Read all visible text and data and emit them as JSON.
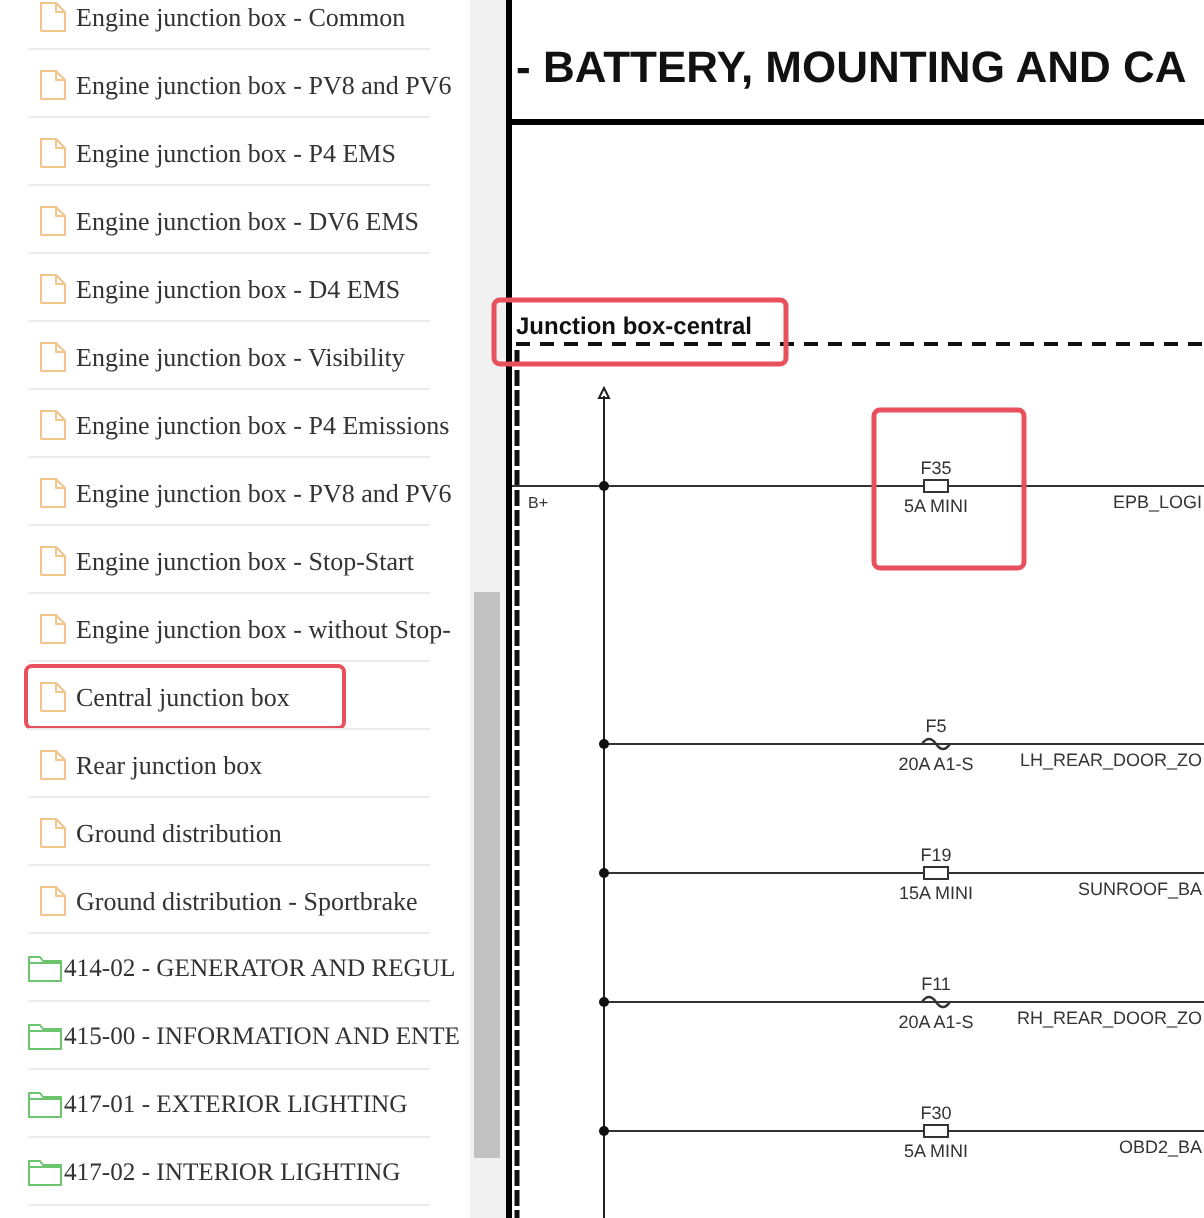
{
  "sidebar": {
    "items": [
      {
        "kind": "file",
        "label": "Engine junction box - Common",
        "highlighted": false
      },
      {
        "kind": "file",
        "label": "Engine junction box - PV8 and PV6",
        "highlighted": false
      },
      {
        "kind": "file",
        "label": "Engine junction box - P4 EMS",
        "highlighted": false
      },
      {
        "kind": "file",
        "label": "Engine junction box - DV6 EMS",
        "highlighted": false
      },
      {
        "kind": "file",
        "label": "Engine junction box - D4 EMS",
        "highlighted": false
      },
      {
        "kind": "file",
        "label": "Engine junction box - Visibility",
        "highlighted": false
      },
      {
        "kind": "file",
        "label": "Engine junction box - P4 Emissions",
        "highlighted": false
      },
      {
        "kind": "file",
        "label": "Engine junction box - PV8 and PV6",
        "highlighted": false
      },
      {
        "kind": "file",
        "label": "Engine junction box - Stop-Start",
        "highlighted": false
      },
      {
        "kind": "file",
        "label": "Engine junction box - without Stop-",
        "highlighted": false
      },
      {
        "kind": "file",
        "label": "Central junction box",
        "highlighted": true
      },
      {
        "kind": "file",
        "label": "Rear junction box",
        "highlighted": false
      },
      {
        "kind": "file",
        "label": "Ground distribution",
        "highlighted": false
      },
      {
        "kind": "file",
        "label": "Ground distribution - Sportbrake",
        "highlighted": false
      },
      {
        "kind": "folder",
        "label": "414-02 - GENERATOR AND REGUL",
        "highlighted": false
      },
      {
        "kind": "folder",
        "label": "415-00 - INFORMATION AND ENTE",
        "highlighted": false
      },
      {
        "kind": "folder",
        "label": "417-01 - EXTERIOR LIGHTING",
        "highlighted": false
      },
      {
        "kind": "folder",
        "label": "417-02 - INTERIOR LIGHTING",
        "highlighted": false
      }
    ]
  },
  "diagram": {
    "title": "- BATTERY, MOUNTING AND CA",
    "junction_box": {
      "label": "Junction box-central",
      "highlighted": true
    },
    "supply": {
      "label": "B+"
    },
    "circuits": [
      {
        "fuse": "F35",
        "rating": "5A MINI",
        "kind": "box",
        "signal": "EPB_LOGI",
        "highlighted": true
      },
      {
        "fuse": "F5",
        "rating": "20A A1-S",
        "kind": "wave",
        "signal": "LH_REAR_DOOR_ZO",
        "highlighted": false
      },
      {
        "fuse": "F19",
        "rating": "15A MINI",
        "kind": "box",
        "signal": "SUNROOF_BA",
        "highlighted": false
      },
      {
        "fuse": "F11",
        "rating": "20A A1-S",
        "kind": "wave",
        "signal": "RH_REAR_DOOR_ZO",
        "highlighted": false
      },
      {
        "fuse": "F30",
        "rating": "5A MINI",
        "kind": "box",
        "signal": "OBD2_BA",
        "highlighted": false
      }
    ]
  }
}
